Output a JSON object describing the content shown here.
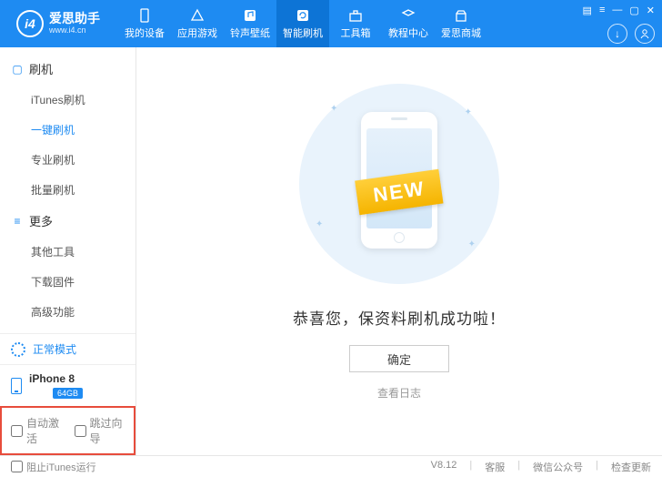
{
  "app": {
    "name": "爱思助手",
    "url": "www.i4.cn",
    "logo_text": "i4"
  },
  "nav": {
    "items": [
      {
        "id": "device",
        "label": "我的设备"
      },
      {
        "id": "apps",
        "label": "应用游戏"
      },
      {
        "id": "ringwall",
        "label": "铃声壁纸"
      },
      {
        "id": "flash",
        "label": "智能刷机",
        "active": true
      },
      {
        "id": "toolbox",
        "label": "工具箱"
      },
      {
        "id": "tutorials",
        "label": "教程中心"
      },
      {
        "id": "mall",
        "label": "爱思商城"
      }
    ]
  },
  "sidebar": {
    "groups": [
      {
        "title": "刷机",
        "glyph": "▢",
        "items": [
          {
            "id": "itunes-flash",
            "label": "iTunes刷机"
          },
          {
            "id": "oneclick",
            "label": "一键刷机",
            "active": true
          },
          {
            "id": "pro",
            "label": "专业刷机"
          },
          {
            "id": "batch",
            "label": "批量刷机"
          }
        ]
      },
      {
        "title": "更多",
        "glyph": "≡",
        "items": [
          {
            "id": "other-tools",
            "label": "其他工具"
          },
          {
            "id": "download-fw",
            "label": "下载固件"
          },
          {
            "id": "advanced",
            "label": "高级功能"
          }
        ]
      }
    ],
    "status": {
      "mode": "正常模式",
      "device_name": "iPhone 8",
      "storage": "64GB"
    },
    "options": {
      "auto_activate": "自动激活",
      "skip_setup": "跳过向导"
    }
  },
  "main": {
    "ribbon": "NEW",
    "headline": "恭喜您，保资料刷机成功啦！",
    "confirm": "确定",
    "view_log": "查看日志"
  },
  "footer": {
    "block_itunes": "阻止iTunes运行",
    "version": "V8.12",
    "links": {
      "support": "客服",
      "wechat": "微信公众号",
      "check_update": "检查更新"
    }
  }
}
